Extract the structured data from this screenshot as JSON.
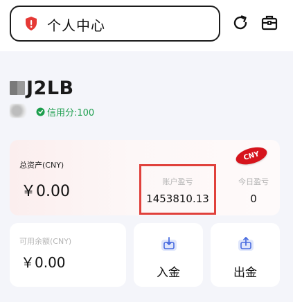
{
  "header": {
    "title": "个人中心",
    "icons": {
      "security": "shield-alert-icon",
      "refresh": "refresh-icon",
      "box": "briefcase-icon"
    }
  },
  "user": {
    "name": "J2LB",
    "credit_label": "信用分:100"
  },
  "assets": {
    "total_label": "总资产(CNY)",
    "total_value": "￥0.00",
    "pnl_label": "账户盈亏",
    "pnl_value": "1453810.13",
    "today_label": "今日盈亏",
    "today_value": "0",
    "currency_badge": "CNY"
  },
  "available": {
    "label": "可用余额(CNY)",
    "value": "￥0.00"
  },
  "actions": {
    "deposit_label": "入金",
    "withdraw_label": "出金"
  },
  "colors": {
    "highlight_border": "#e0413c",
    "credit_green": "#1c9e4d",
    "badge_red": "#d6141c",
    "icon_accent": "#4a6de0"
  }
}
